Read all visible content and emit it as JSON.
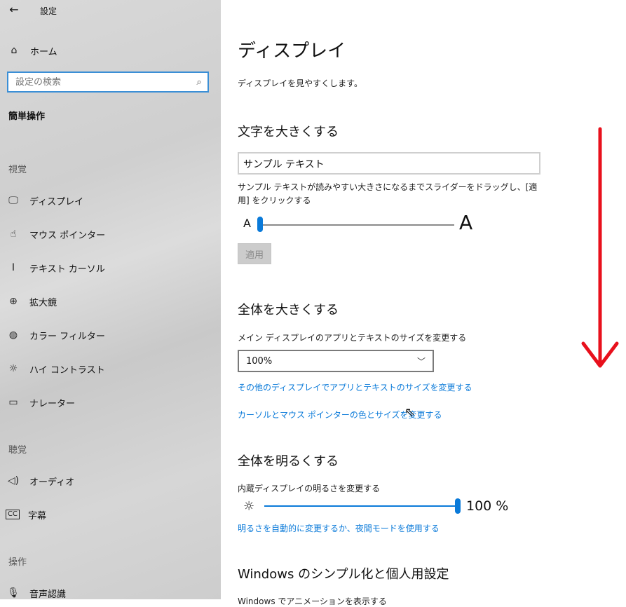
{
  "window": {
    "title": "設定"
  },
  "sidebar": {
    "home_label": "ホーム",
    "search_placeholder": "設定の検索",
    "group_title": "簡単操作",
    "sections": [
      {
        "label": "視覚",
        "items": [
          {
            "label": "ディスプレイ",
            "icon": "monitor-icon"
          },
          {
            "label": "マウス ポインター",
            "icon": "mouse-pointer-icon"
          },
          {
            "label": "テキスト カーソル",
            "icon": "text-cursor-icon"
          },
          {
            "label": "拡大鏡",
            "icon": "magnifier-icon"
          },
          {
            "label": "カラー フィルター",
            "icon": "color-filter-icon"
          },
          {
            "label": "ハイ コントラスト",
            "icon": "high-contrast-icon"
          },
          {
            "label": "ナレーター",
            "icon": "narrator-icon"
          }
        ]
      },
      {
        "label": "聴覚",
        "items": [
          {
            "label": "オーディオ",
            "icon": "audio-icon"
          },
          {
            "label": "字幕",
            "icon": "captions-icon"
          }
        ]
      },
      {
        "label": "操作",
        "items": [
          {
            "label": "音声認識",
            "icon": "microphone-icon"
          }
        ]
      }
    ]
  },
  "main": {
    "title": "ディスプレイ",
    "description": "ディスプレイを見やすくします。",
    "text_size": {
      "heading": "文字を大きくする",
      "sample_text": "サンプル テキスト",
      "instruction": "サンプル テキストが読みやすい大きさになるまでスライダーをドラッグし、[適用] をクリックする",
      "small_a": "A",
      "large_a": "A",
      "slider_value": 0,
      "apply_label": "適用"
    },
    "scale": {
      "heading": "全体を大きくする",
      "label": "メイン ディスプレイのアプリとテキストのサイズを変更する",
      "selected": "100%",
      "link1": "その他のディスプレイでアプリとテキストのサイズを変更する",
      "link2": "カーソルとマウス ポインターの色とサイズを変更する"
    },
    "brightness": {
      "heading": "全体を明るくする",
      "label": "内蔵ディスプレイの明るさを変更する",
      "value_text": "100 %",
      "value": 100,
      "link": "明るさを自動的に変更するか、夜間モードを使用する"
    },
    "simplify": {
      "heading": "Windows のシンプル化と個人用設定",
      "cut_text": "Windows でアニメーションを表示する"
    }
  },
  "colors": {
    "accent": "#0a7ad9",
    "annotation": "#e8101c"
  }
}
